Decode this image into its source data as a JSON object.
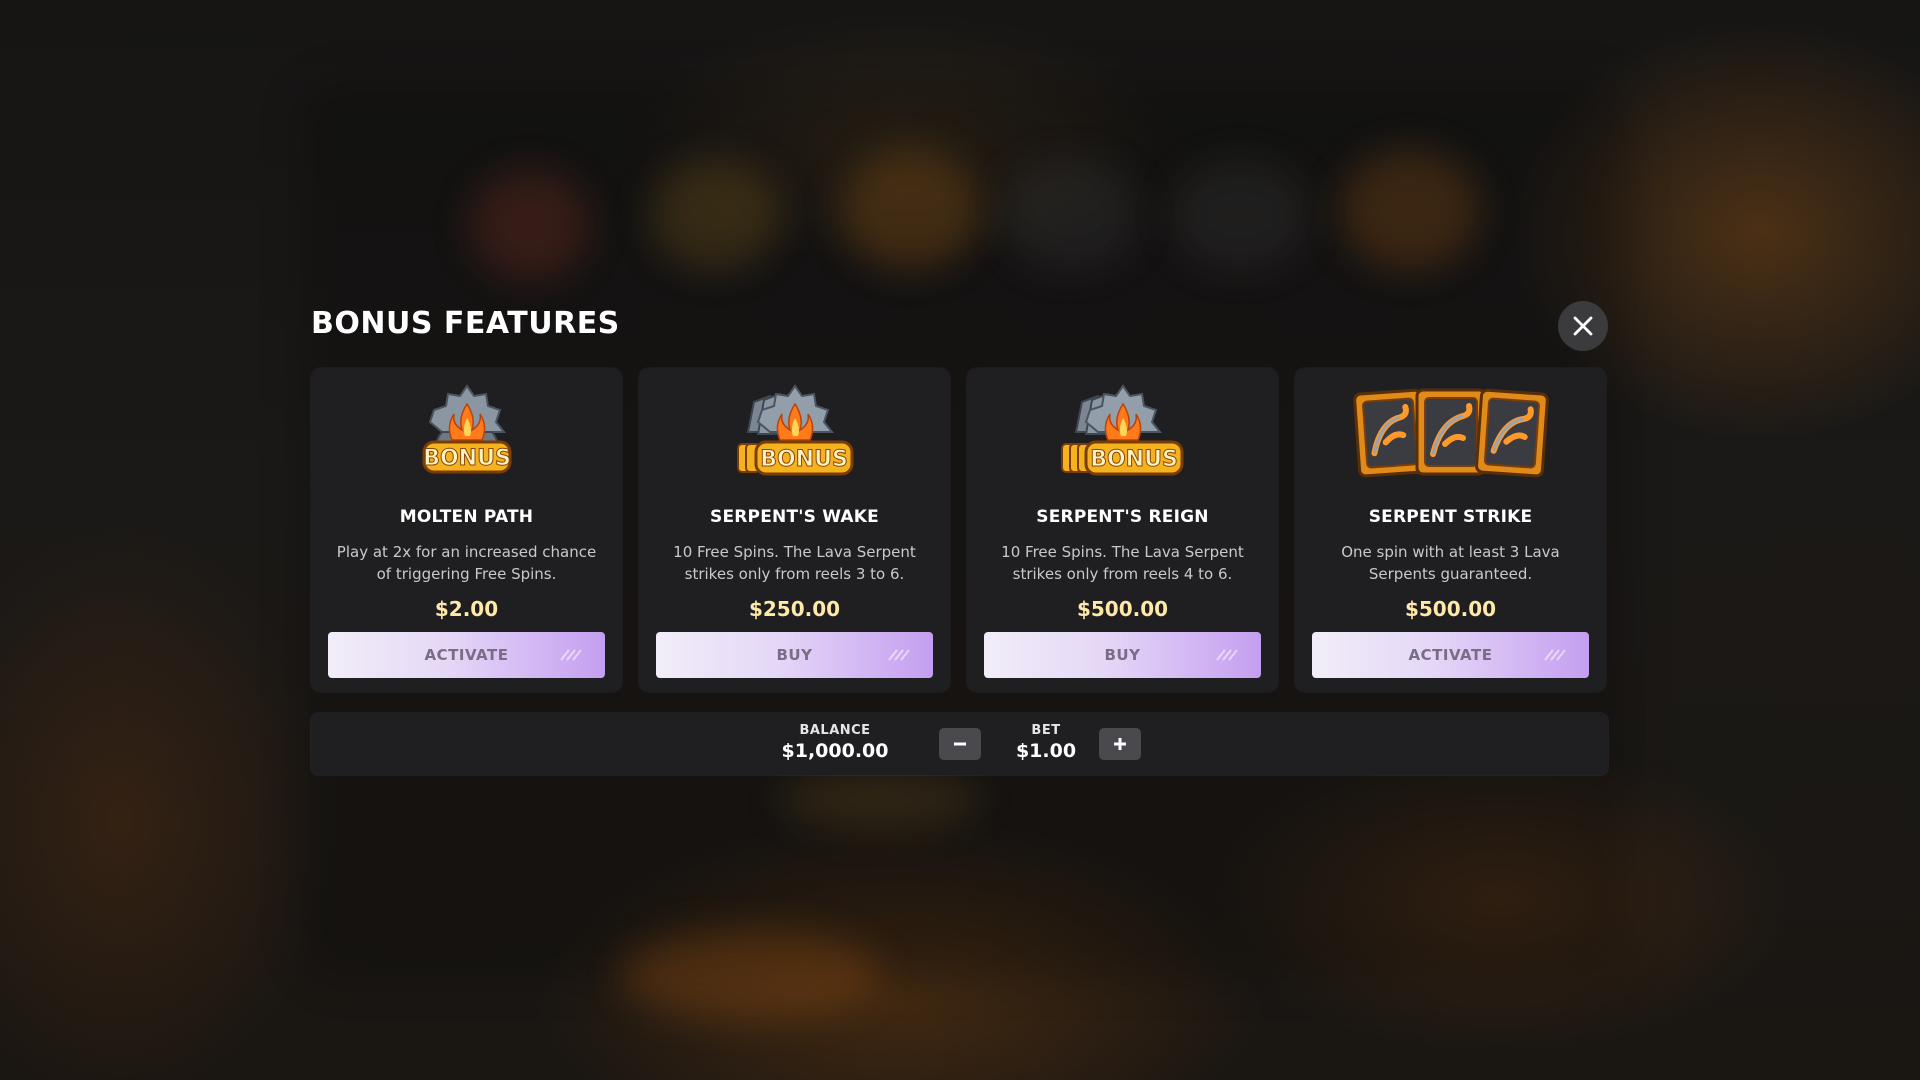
{
  "modal": {
    "title": "BONUS FEATURES",
    "close_icon": "close-icon"
  },
  "features": [
    {
      "name": "MOLTEN PATH",
      "description": "Play at 2x for an increased chance of triggering Free Spins.",
      "price": "$2.00",
      "action_label": "ACTIVATE",
      "art": "single-bonus-badge-icon"
    },
    {
      "name": "SERPENT'S WAKE",
      "description": "10 Free Spins. The Lava Serpent strikes only from reels 3 to 6.",
      "price": "$250.00",
      "action_label": "BUY",
      "art": "stacked-bonus-badge-icon"
    },
    {
      "name": "SERPENT'S REIGN",
      "description": "10 Free Spins. The Lava Serpent strikes only from reels 4 to 6.",
      "price": "$500.00",
      "action_label": "BUY",
      "art": "stacked-bonus-badge-icon"
    },
    {
      "name": "SERPENT STRIKE",
      "description": "One spin with at least 3 Lava Serpents guaranteed.",
      "price": "$500.00",
      "action_label": "ACTIVATE",
      "art": "three-serpent-tiles-icon"
    }
  ],
  "bet_bar": {
    "balance_label": "BALANCE",
    "balance_value": "$1,000.00",
    "bet_label": "BET",
    "bet_value": "$1.00",
    "decrease_icon": "minus-icon",
    "increase_icon": "plus-icon"
  },
  "colors": {
    "card_bg": "#1f1f21",
    "price": "#ffe9a8",
    "button_gradient_end": "#c49ef0",
    "bonus_gold": "#f2a31a"
  }
}
